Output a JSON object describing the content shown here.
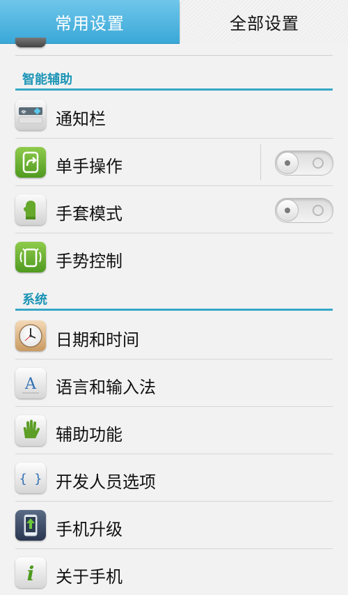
{
  "tabs": {
    "common": "常用设置",
    "all": "全部设置",
    "selected": "all"
  },
  "sections": [
    {
      "title": "智能辅助",
      "items": [
        {
          "label": "通知栏",
          "icon": "notification-bar-icon"
        },
        {
          "label": "单手操作",
          "icon": "one-hand-icon",
          "toggle": "off"
        },
        {
          "label": "手套模式",
          "icon": "glove-icon",
          "toggle": "off"
        },
        {
          "label": "手势控制",
          "icon": "gesture-icon"
        }
      ]
    },
    {
      "title": "系统",
      "items": [
        {
          "label": "日期和时间",
          "icon": "clock-icon"
        },
        {
          "label": "语言和输入法",
          "icon": "language-icon",
          "icon_text": "A"
        },
        {
          "label": "辅助功能",
          "icon": "hand-icon"
        },
        {
          "label": "开发人员选项",
          "icon": "developer-braces-icon",
          "icon_text": "{ }"
        },
        {
          "label": "手机升级",
          "icon": "phone-upgrade-icon"
        },
        {
          "label": "关于手机",
          "icon": "info-icon",
          "icon_text": "i"
        }
      ]
    }
  ],
  "colors": {
    "tab_active_bg": "#3aa8d8",
    "section_header": "#1b94b5",
    "section_rule": "#35a7c6",
    "background": "#f2f2f2"
  }
}
